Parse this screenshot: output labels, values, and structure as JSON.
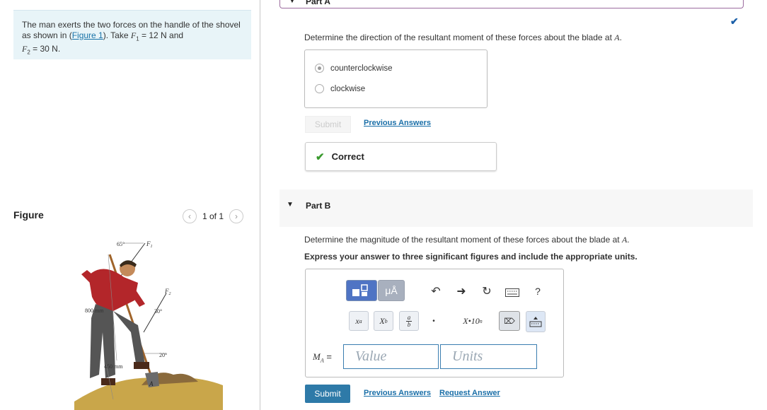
{
  "problem": {
    "text_before": "The man exerts the two forces on the handle of the shovel as shown in (",
    "figure_link": "Figure 1",
    "text_after": "). Take ",
    "f1_sym": "F",
    "f1_sub": "1",
    "f1_eq": " = 12 N and",
    "f2_sym": "F",
    "f2_sub": "2",
    "f2_eq": " = 30 N."
  },
  "figure": {
    "title": "Figure",
    "counter": "1 of 1",
    "prev_icon": "chevron-left-icon",
    "next_icon": "chevron-right-icon",
    "labels": {
      "angle_top": "65°",
      "f1": "F",
      "f1_sub": "1",
      "f2": "F",
      "f2_sub": "2",
      "angle_mid": "30°",
      "dist_top": "800 mm",
      "angle_bottom": "20°",
      "dist_bottom": "450 mm",
      "point": "A"
    }
  },
  "partA": {
    "label": "Part A",
    "question_before": "Determine the direction of the resultant moment of these forces about the blade at ",
    "question_sym": "A",
    "question_after": ".",
    "options": [
      {
        "label": "counterclockwise",
        "selected": true
      },
      {
        "label": "clockwise",
        "selected": false
      }
    ],
    "submit_label": "Submit",
    "previous_answers": "Previous Answers",
    "feedback": "Correct",
    "status_icon": "check-icon"
  },
  "partB": {
    "label": "Part B",
    "question_before": "Determine the magnitude of the resultant moment of these forces about the blade at ",
    "question_sym": "A",
    "question_after": ".",
    "instruction": "Express your answer to three significant figures and include the appropriate units.",
    "toolbar": {
      "units_btn": "μÅ",
      "undo_icon": "undo-icon",
      "redo_icon": "redo-icon",
      "reset_icon": "reset-icon",
      "keyboard_icon": "keyboard-icon",
      "help": "?",
      "superscript": "x",
      "superscript_sup": "a",
      "subscript": "X",
      "subscript_sub": "b",
      "fraction_num": "a",
      "fraction_den": "b",
      "dot": "•",
      "sci_notation": "X•10",
      "sci_sup": "n"
    },
    "answer_label_sym": "M",
    "answer_label_sub": "A",
    "answer_label_eq": " =",
    "value_placeholder": "Value",
    "units_placeholder": "Units",
    "submit_label": "Submit",
    "previous_answers": "Previous Answers",
    "request_answer": "Request Answer"
  }
}
